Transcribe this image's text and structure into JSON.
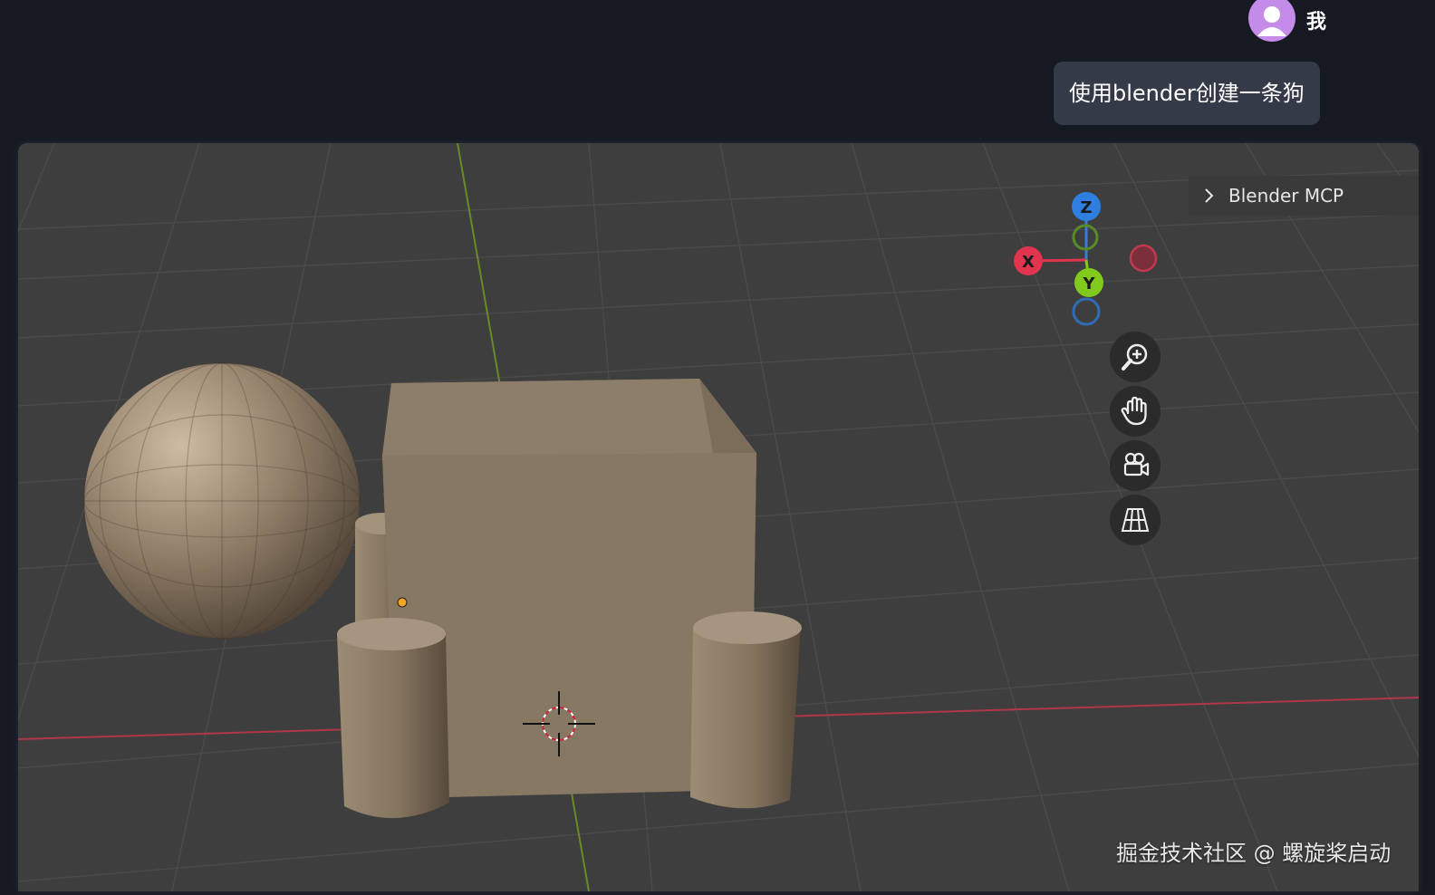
{
  "header": {
    "avatar_icon": "user-avatar-icon",
    "avatar_color": "#c58be8",
    "username": "我"
  },
  "chat": {
    "message": "使用blender创建一条狗"
  },
  "viewport": {
    "panel_title": "Blender MCP",
    "gizmo": {
      "z_label": "Z",
      "x_label": "X",
      "y_label": "Y",
      "z_color": "#2f7fe0",
      "x_color": "#e0344f",
      "y_color": "#82c91e"
    },
    "nav_icons": [
      "zoom-icon",
      "pan-hand-icon",
      "camera-icon",
      "perspective-grid-icon"
    ],
    "watermark": "掘金技术社区 @ 螺旋桨启动"
  },
  "colors": {
    "background": "#151922",
    "viewport_bg": "#3e3e3e",
    "bubble_bg": "#343a48",
    "mesh": "#8a7a66"
  }
}
